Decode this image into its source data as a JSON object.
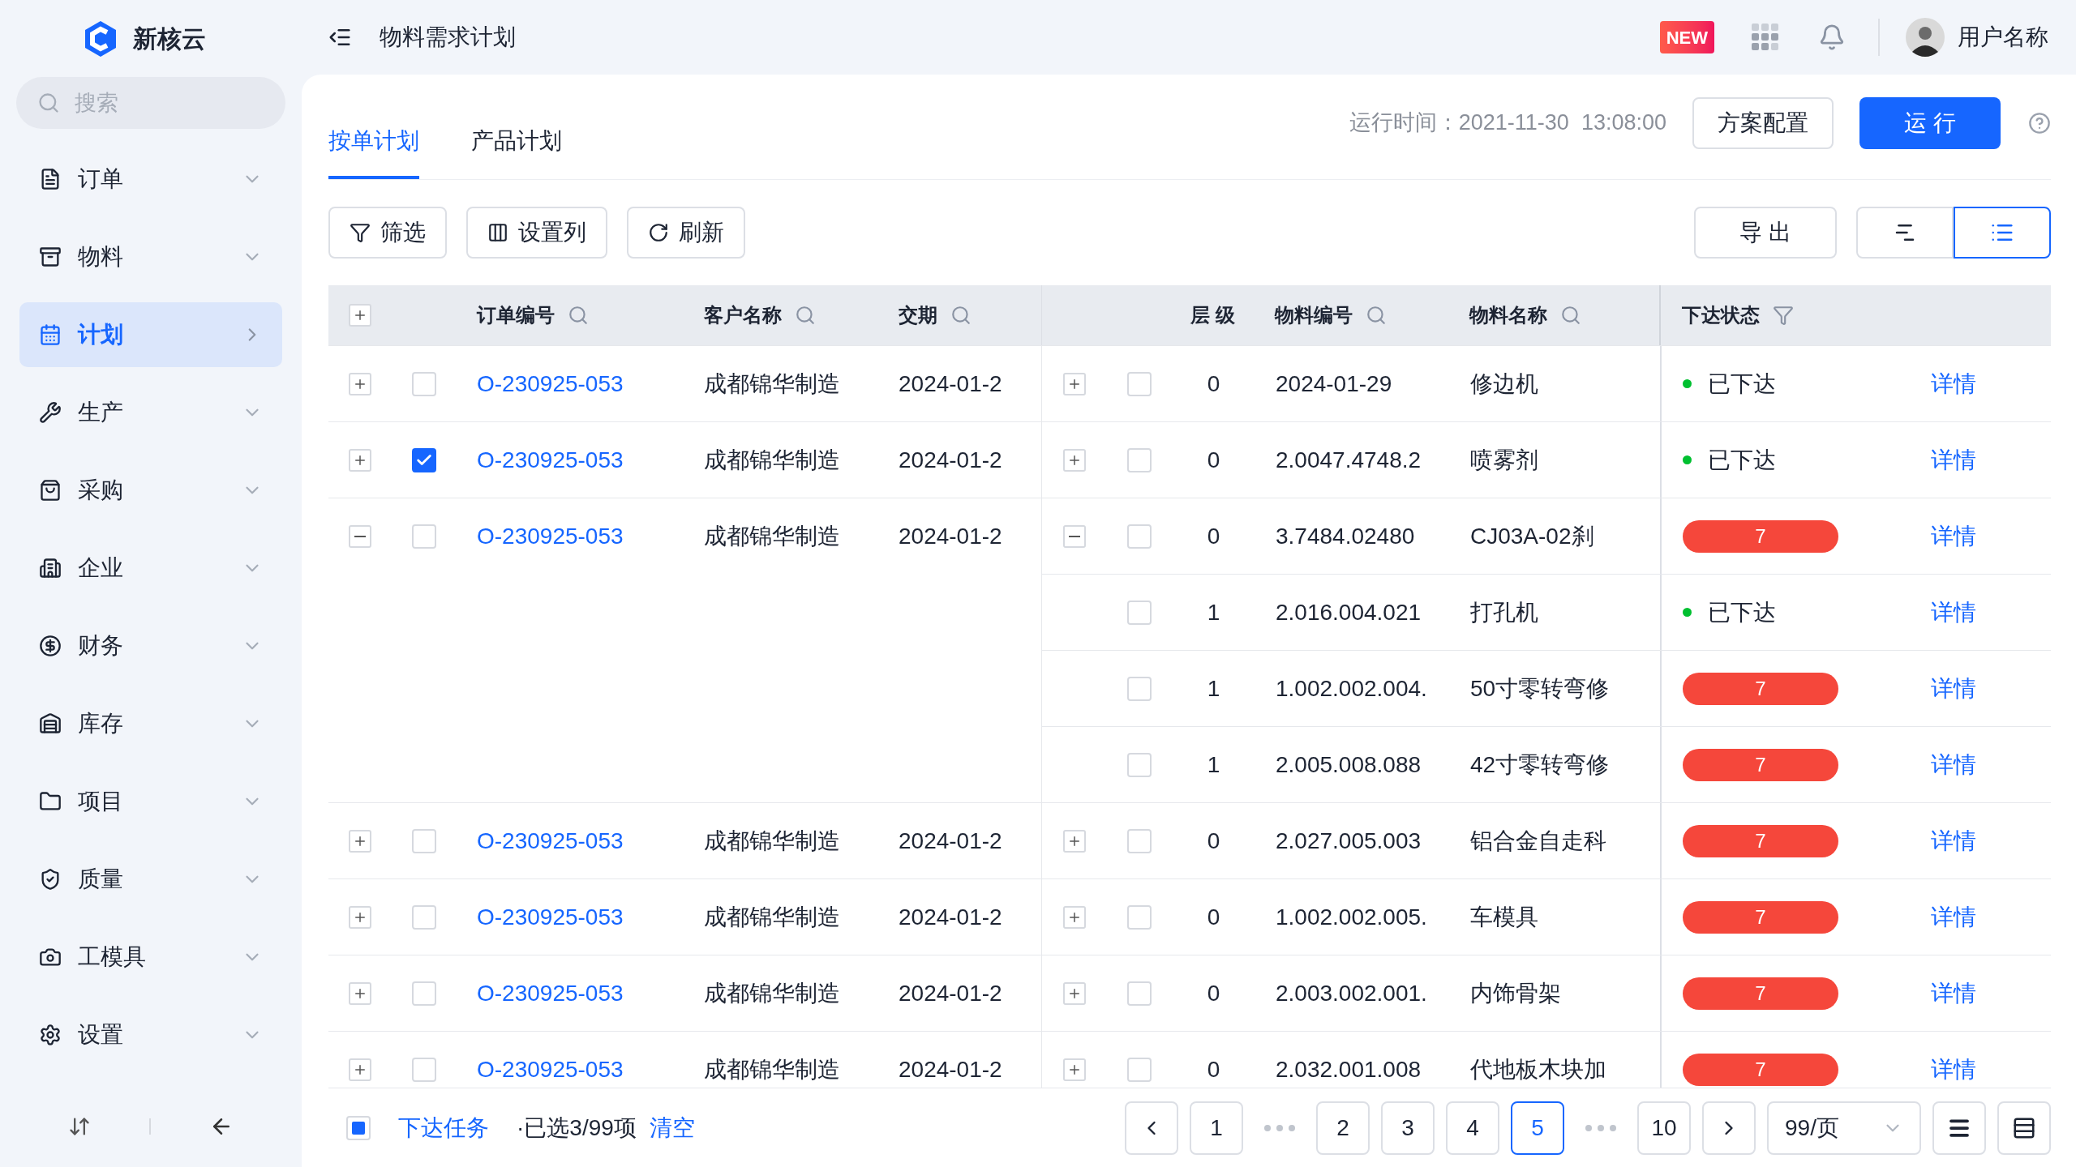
{
  "app": {
    "name": "新核云"
  },
  "header": {
    "title": "物料需求计划",
    "new_badge": "NEW",
    "user_name": "用户名称"
  },
  "sidebar": {
    "search": {
      "placeholder": "搜索"
    },
    "items": [
      {
        "label": "订单",
        "selected": false
      },
      {
        "label": "物料",
        "selected": false
      },
      {
        "label": "计划",
        "selected": true
      },
      {
        "label": "生产",
        "selected": false
      },
      {
        "label": "采购",
        "selected": false
      },
      {
        "label": "企业",
        "selected": false
      },
      {
        "label": "财务",
        "selected": false
      },
      {
        "label": "库存",
        "selected": false
      },
      {
        "label": "项目",
        "selected": false
      },
      {
        "label": "质量",
        "selected": false
      },
      {
        "label": "工模具",
        "selected": false
      },
      {
        "label": "设置",
        "selected": false
      }
    ]
  },
  "tabs": [
    {
      "label": "按单计划",
      "selected": true
    },
    {
      "label": "产品计划",
      "selected": false
    }
  ],
  "run_time": "运行时间：2021-11-30  13:08:00",
  "top_buttons": {
    "config": "方案配置",
    "run": "运 行"
  },
  "toolbar": {
    "filter": "筛选",
    "columns": "设置列",
    "refresh": "刷新",
    "export": "导 出"
  },
  "view_toggle": [
    {
      "kind": "gantt",
      "selected": false
    },
    {
      "kind": "list",
      "selected": true
    }
  ],
  "table": {
    "columns": {
      "order_no": "订单编号",
      "customer": "客户名称",
      "due_date": "交期",
      "level": "层 级",
      "material_code": "物料编号",
      "material_name": "物料名称",
      "status": "下达状态"
    },
    "rows": [
      {
        "expanded": false,
        "selected": false,
        "order_no": "O-230925-053",
        "customer": "成都锦华制造",
        "due_date": "2024-01-2",
        "material": {
          "expanded": false,
          "selected": false,
          "level": "0",
          "code": "2024-01-29",
          "name": "修边机",
          "status": {
            "kind": "dot",
            "text": "已下达",
            "color": "#00c030"
          },
          "action": "详情"
        }
      },
      {
        "expanded": false,
        "selected": true,
        "order_no": "O-230925-053",
        "customer": "成都锦华制造",
        "due_date": "2024-01-2",
        "material": {
          "expanded": false,
          "selected": false,
          "level": "0",
          "code": "2.0047.4748.2",
          "name": "喷雾剂",
          "status": {
            "kind": "dot",
            "text": "已下达",
            "color": "#00c030"
          },
          "action": "详情"
        }
      },
      {
        "expanded": true,
        "selected": false,
        "order_no": "O-230925-053",
        "customer": "成都锦华制造",
        "due_date": "2024-01-2",
        "material": {
          "expanded": true,
          "selected": false,
          "level": "0",
          "code": "3.7484.02480",
          "name": "CJ03A-02刹",
          "status": {
            "kind": "badge",
            "text": "7",
            "color": "#f5473b"
          },
          "action": "详情",
          "children": [
            {
              "selected": false,
              "level": "1",
              "code": "2.016.004.021",
              "name": "打孔机",
              "status": {
                "kind": "dot",
                "text": "已下达",
                "color": "#00c030"
              },
              "action": "详情"
            },
            {
              "selected": false,
              "level": "1",
              "code": "1.002.002.004.",
              "name": "50寸零转弯修",
              "status": {
                "kind": "badge",
                "text": "7",
                "color": "#f5473b"
              },
              "action": "详情"
            },
            {
              "selected": false,
              "level": "1",
              "code": "2.005.008.088",
              "name": "42寸零转弯修",
              "status": {
                "kind": "badge",
                "text": "7",
                "color": "#f5473b"
              },
              "action": "详情"
            }
          ]
        }
      },
      {
        "expanded": false,
        "selected": false,
        "order_no": "O-230925-053",
        "customer": "成都锦华制造",
        "due_date": "2024-01-2",
        "material": {
          "expanded": false,
          "selected": false,
          "level": "0",
          "code": "2.027.005.003",
          "name": "铝合金自走科",
          "status": {
            "kind": "badge",
            "text": "7",
            "color": "#f5473b"
          },
          "action": "详情"
        }
      },
      {
        "expanded": false,
        "selected": false,
        "order_no": "O-230925-053",
        "customer": "成都锦华制造",
        "due_date": "2024-01-2",
        "material": {
          "expanded": false,
          "selected": false,
          "level": "0",
          "code": "1.002.002.005.",
          "name": "车模具",
          "status": {
            "kind": "badge",
            "text": "7",
            "color": "#f5473b"
          },
          "action": "详情"
        }
      },
      {
        "expanded": false,
        "selected": false,
        "order_no": "O-230925-053",
        "customer": "成都锦华制造",
        "due_date": "2024-01-2",
        "material": {
          "expanded": false,
          "selected": false,
          "level": "0",
          "code": "2.003.002.001.",
          "name": "内饰骨架",
          "status": {
            "kind": "badge",
            "text": "7",
            "color": "#f5473b"
          },
          "action": "详情"
        }
      },
      {
        "expanded": false,
        "selected": false,
        "order_no": "O-230925-053",
        "customer": "成都锦华制造",
        "due_date": "2024-01-2",
        "material": {
          "expanded": false,
          "selected": false,
          "level": "0",
          "code": "2.032.001.008",
          "name": "代地板木块加",
          "status": {
            "kind": "badge",
            "text": "7",
            "color": "#f5473b"
          },
          "action": "详情"
        }
      }
    ]
  },
  "footer": {
    "select_all": {
      "checked": false,
      "partial": true
    },
    "release": "下达任务",
    "selected_info": "·已选3/99项",
    "clear": "清空"
  },
  "pagination": {
    "pages": [
      {
        "kind": "page",
        "label": "1",
        "selected": false
      },
      {
        "kind": "ellipsis"
      },
      {
        "kind": "page",
        "label": "2",
        "selected": false
      },
      {
        "kind": "page",
        "label": "3",
        "selected": false
      },
      {
        "kind": "page",
        "label": "4",
        "selected": false
      },
      {
        "kind": "page",
        "label": "5",
        "selected": true
      },
      {
        "kind": "ellipsis"
      },
      {
        "kind": "page",
        "label": "10",
        "selected": false
      }
    ],
    "page_size": "99/页"
  }
}
